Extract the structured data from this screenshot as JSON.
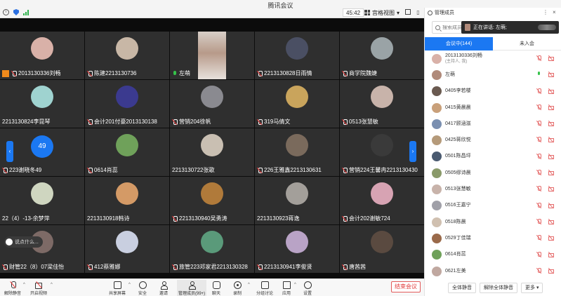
{
  "window": {
    "title": "腾讯会议",
    "timer": "45:42",
    "view_label": "宫格视图"
  },
  "colors": {
    "accent": "#1b78f2",
    "danger": "#e03b3b",
    "host_badge": "#f08a1c",
    "mic_on": "#36c24a"
  },
  "video": {
    "tiles": [
      {
        "name": "2013130336刘畅",
        "avatar": "#d9b1a8",
        "mic": "off",
        "host": true
      },
      {
        "name": "陈建2213130736",
        "avatar": "#c8b7a6",
        "mic": "off"
      },
      {
        "name": "左萌",
        "avatar": "photo",
        "mic": "on"
      },
      {
        "name": "2213130828日雨情",
        "avatar": "#4a4f63",
        "mic": "off"
      },
      {
        "name": "商学院魏婕",
        "avatar": "#9aa3a6",
        "mic": "off"
      },
      {
        "name": "2213130824李昆琴",
        "avatar": "#9fd3d0",
        "mic": "none"
      },
      {
        "name": "会计201付豪2013130138",
        "avatar": "#3b3a8f",
        "mic": "off"
      },
      {
        "name": "营销204徐帆",
        "avatar": "#8a8a90",
        "mic": "off"
      },
      {
        "name": "319马倩文",
        "avatar": "#c9a45c",
        "mic": "off"
      },
      {
        "name": "0513张慧敏",
        "avatar": "#c8b3aa",
        "mic": "off"
      },
      {
        "name": "223谢晓冬49",
        "avatar": "count",
        "count": "49",
        "mic": "off"
      },
      {
        "name": "0614肖蕊",
        "avatar": "#6fa15a",
        "mic": "off"
      },
      {
        "name": "2213130722张歌",
        "avatar": "#c9bfb2",
        "mic": "none"
      },
      {
        "name": "226王雅鑫2213130631",
        "avatar": "#7a6a5c",
        "mic": "off"
      },
      {
        "name": "营销224王馨冉2213130430",
        "avatar": "#3a3a3a",
        "mic": "off"
      },
      {
        "name": "22（4）-13-余梦萍",
        "avatar": "#cfd6c0",
        "mic": "none"
      },
      {
        "name": "2213130918韩诗",
        "avatar": "#d49a66",
        "mic": "none"
      },
      {
        "name": "2213130940吴勇涛",
        "avatar": "#b07a3a",
        "mic": "off"
      },
      {
        "name": "2213130923蒋逸",
        "avatar": "#a39f9a",
        "mic": "none"
      },
      {
        "name": "会计202谢敏724",
        "avatar": "#d7a3b3",
        "mic": "off"
      },
      {
        "name": "财管22（8）07梁佳怡",
        "avatar": "#7d6a66",
        "mic": "off"
      },
      {
        "name": "412蔡雅娜",
        "avatar": "#c9cfe0",
        "mic": "off"
      },
      {
        "name": "旅管223邓家君2213130328",
        "avatar": "#5a9a7a",
        "mic": "off"
      },
      {
        "name": "2213130941李俊贤",
        "avatar": "#b9a3c6",
        "mic": "off"
      },
      {
        "name": "唐茜茜",
        "avatar": "#5a4a40",
        "mic": "off"
      }
    ],
    "chat_placeholder": "说点什么..."
  },
  "toolbar": {
    "mute": "解除静音",
    "video": "开启视频",
    "share": "共享屏幕",
    "security": "安全",
    "invite": "邀请",
    "members": "管理成员(99+)",
    "chat": "聊天",
    "record": "录制",
    "breakout": "分组讨论",
    "apps": "应用",
    "settings": "设置",
    "end": "结束会议"
  },
  "panel": {
    "title": "管理成员",
    "search_placeholder": "搜索成员",
    "speaking_label": "正在讲话: 左萌;",
    "tabs": {
      "in_meeting": "会议中(144)",
      "not_joined": "未入会"
    },
    "members": [
      {
        "name": "2013130336刘畅",
        "sub": "(主持人, 我)",
        "avatar": "#d9b1a8",
        "mic": "off",
        "cam": "off"
      },
      {
        "name": "左萌",
        "sub": "",
        "avatar": "#b08a7a",
        "mic": "on",
        "cam": "off"
      },
      {
        "name": "0405李若楼",
        "sub": "",
        "avatar": "#6a5a50",
        "mic": "off",
        "cam": "off"
      },
      {
        "name": "0415黄晨晨",
        "sub": "",
        "avatar": "#c9a07a",
        "mic": "off",
        "cam": "off"
      },
      {
        "name": "0417顾涵滋",
        "sub": "",
        "avatar": "#7a8fb0",
        "mic": "off",
        "cam": "off"
      },
      {
        "name": "0425蒋欣悦",
        "sub": "",
        "avatar": "#b59a7a",
        "mic": "off",
        "cam": "off"
      },
      {
        "name": "0501陈昌坪",
        "sub": "",
        "avatar": "#4a5a70",
        "mic": "off",
        "cam": "off"
      },
      {
        "name": "0505缪诗晨",
        "sub": "",
        "avatar": "#8a9a6a",
        "mic": "off",
        "cam": "off"
      },
      {
        "name": "0513张慧敏",
        "sub": "",
        "avatar": "#c8b3aa",
        "mic": "off",
        "cam": "off"
      },
      {
        "name": "0516王嘉宁",
        "sub": "",
        "avatar": "#a0a0a8",
        "mic": "off",
        "cam": "off"
      },
      {
        "name": "0518陈晨",
        "sub": "",
        "avatar": "#d0c0b0",
        "mic": "off",
        "cam": "off"
      },
      {
        "name": "0529丁佳瑞",
        "sub": "",
        "avatar": "#9a6a4a",
        "mic": "off",
        "cam": "off"
      },
      {
        "name": "0614肖蕊",
        "sub": "",
        "avatar": "#6fa15a",
        "mic": "off",
        "cam": "off"
      },
      {
        "name": "0621左美",
        "sub": "",
        "avatar": "#c0a8a0",
        "mic": "off",
        "cam": "off"
      }
    ],
    "footer": {
      "mute_all": "全体静音",
      "unmute_all": "解除全体静音",
      "more": "更多"
    }
  }
}
